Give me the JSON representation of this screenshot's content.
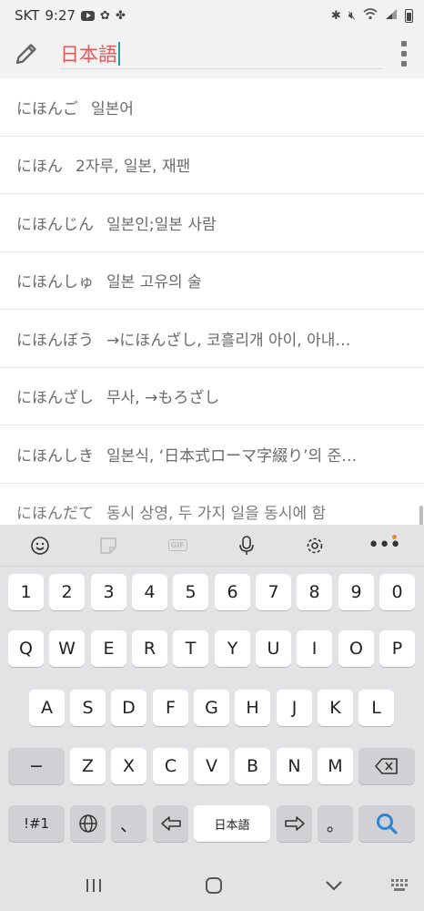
{
  "status_bar": {
    "carrier": "SKT",
    "time": "9:27",
    "icons_left": [
      "youtube-icon",
      "fan-icon",
      "pinwheel-icon"
    ],
    "icons_right": [
      "bluetooth-icon",
      "mute-icon",
      "wifi-icon",
      "signal-icon",
      "battery-icon"
    ]
  },
  "search": {
    "query": "日本語",
    "query_color": "#e05a5a",
    "left_icon": "pencil-icon",
    "right_icon": "kebab-menu-icon"
  },
  "results": [
    {
      "word": "にほんご",
      "meaning": "일본어"
    },
    {
      "word": "にほん",
      "meaning": "2자루, 일본, 재팬"
    },
    {
      "word": "にほんじん",
      "meaning": "일본인;일본 사람"
    },
    {
      "word": "にほんしゅ",
      "meaning": "일본 고유의 술"
    },
    {
      "word": "にほんぼう",
      "meaning": "→にほんざし, 코흘리개 아이, 아내…"
    },
    {
      "word": "にほんざし",
      "meaning": "무사, →もろざし"
    },
    {
      "word": "にほんしき",
      "meaning": "일본식, ‘日本式ローマ字綴り’의 준…"
    },
    {
      "word": "にほんだて",
      "meaning": "동시 상영, 두 가지 일을 동시에 함"
    }
  ],
  "keyboard": {
    "toolbar": [
      "emoji-icon",
      "sticker-icon",
      "gif-icon",
      "microphone-icon",
      "settings-icon",
      "more-icon"
    ],
    "gif_label": "GIF",
    "more_label": "•••",
    "numbers": [
      "1",
      "2",
      "3",
      "4",
      "5",
      "6",
      "7",
      "8",
      "9",
      "0"
    ],
    "row1": [
      "Q",
      "W",
      "E",
      "R",
      "T",
      "Y",
      "U",
      "I",
      "O",
      "P"
    ],
    "row2": [
      "A",
      "S",
      "D",
      "F",
      "G",
      "H",
      "J",
      "K",
      "L"
    ],
    "row3": [
      "−",
      "Z",
      "X",
      "C",
      "V",
      "B",
      "N",
      "M"
    ],
    "symbols_label": "!#1",
    "comma_label": "、",
    "space_label": "日本語",
    "period_label": "。",
    "accent_color": "#2b86d6"
  },
  "nav_bar": [
    "recent-apps-icon",
    "home-icon",
    "back-icon",
    "keyboard-switch-icon"
  ]
}
